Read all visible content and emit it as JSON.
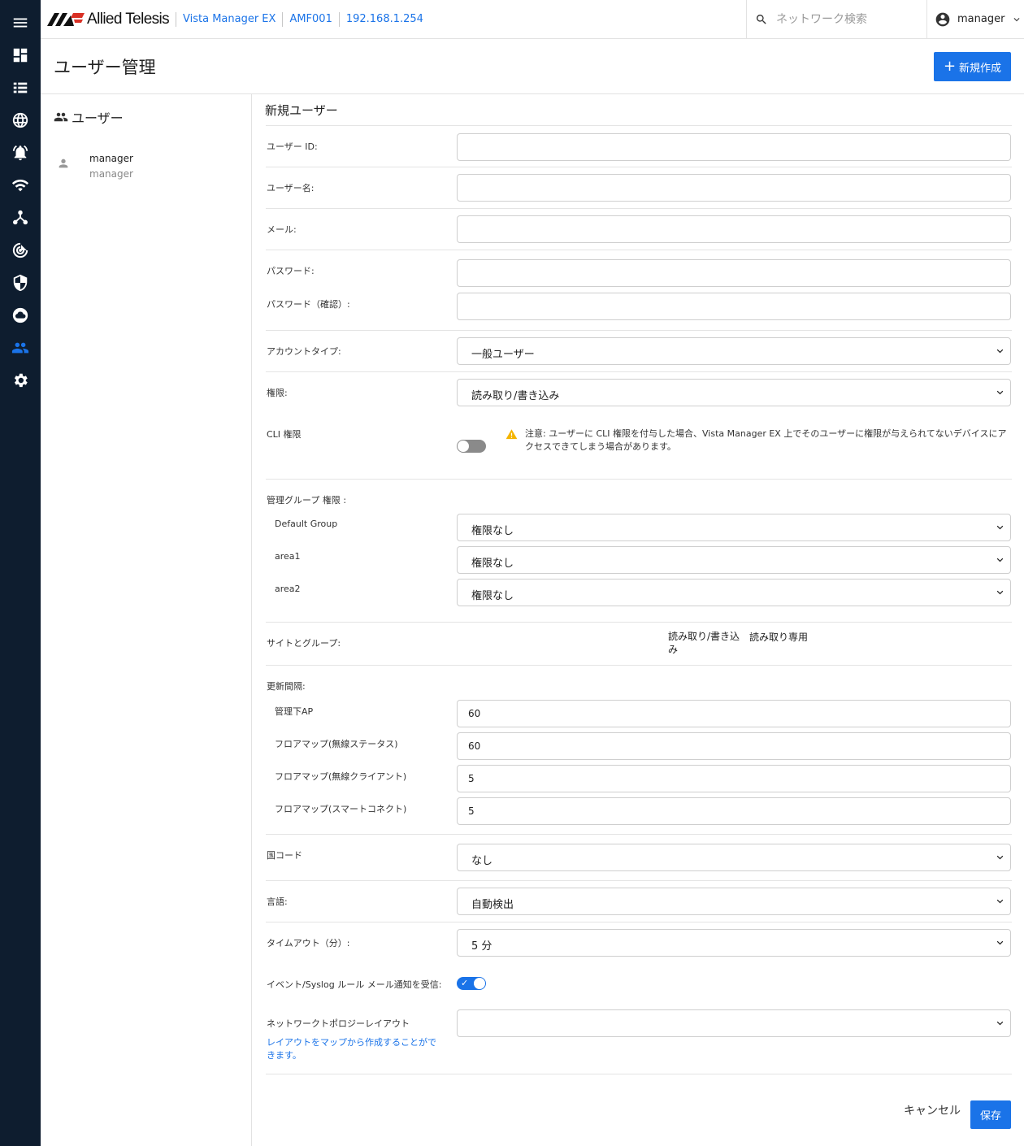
{
  "header": {
    "logo_text": "Allied Telesis",
    "breadcrumb": [
      "Vista Manager EX",
      "AMF001",
      "192.168.1.254"
    ],
    "search_placeholder": "ネットワーク検索",
    "user": "manager"
  },
  "page": {
    "title": "ユーザー管理",
    "new_button": "新規作成"
  },
  "user_panel": {
    "heading": "ユーザー",
    "users": [
      {
        "name": "manager",
        "sub": "manager"
      }
    ]
  },
  "form": {
    "title": "新規ユーザー",
    "user_id_label": "ユーザー ID:",
    "username_label": "ユーザー名:",
    "email_label": "メール:",
    "password_label": "パスワード:",
    "password_confirm_label": "パスワード（確認）:",
    "account_type_label": "アカウントタイプ:",
    "account_type_value": "一般ユーザー",
    "permission_label": "権限:",
    "permission_value": "読み取り/書き込み",
    "cli_label": "CLI 権限",
    "cli_enabled": false,
    "cli_warning": "注意: ユーザーに CLI 権限を付与した場合、Vista Manager EX 上でそのユーザーに権限が与えられてないデバイスにアクセスできてしまう場合があります。",
    "mgmt_group_label": "管理グループ 権限 :",
    "groups": [
      {
        "name": "Default Group",
        "value": "権限なし"
      },
      {
        "name": "area1",
        "value": "権限なし"
      },
      {
        "name": "area2",
        "value": "権限なし"
      }
    ],
    "sites_label": "サイトとグループ:",
    "sites_cols": {
      "rw_line1": "読み取り/書き込",
      "rw_line2": "み",
      "ro": "読み取り専用"
    },
    "refresh_label": "更新間隔:",
    "refresh": [
      {
        "name": "管理下AP",
        "value": "60"
      },
      {
        "name": "フロアマップ(無線ステータス)",
        "value": "60"
      },
      {
        "name": "フロアマップ(無線クライアント)",
        "value": "5"
      },
      {
        "name": "フロアマップ(スマートコネクト)",
        "value": "5"
      }
    ],
    "country_label": "国コード",
    "country_value": "なし",
    "language_label": "言語:",
    "language_value": "自動検出",
    "timeout_label": "タイムアウト（分）:",
    "timeout_value": "5 分",
    "syslog_label": "イベント/Syslog ルール メール通知を受信:",
    "syslog_enabled": true,
    "topology_label": "ネットワークトポロジーレイアウト",
    "topology_value": "",
    "topology_link": "レイアウトをマップから作成することができます。",
    "cancel": "キャンセル",
    "save": "保存"
  },
  "colors": {
    "accent": "#1a73e8",
    "rail": "#0e1d2f",
    "warning": "#f4b400"
  }
}
